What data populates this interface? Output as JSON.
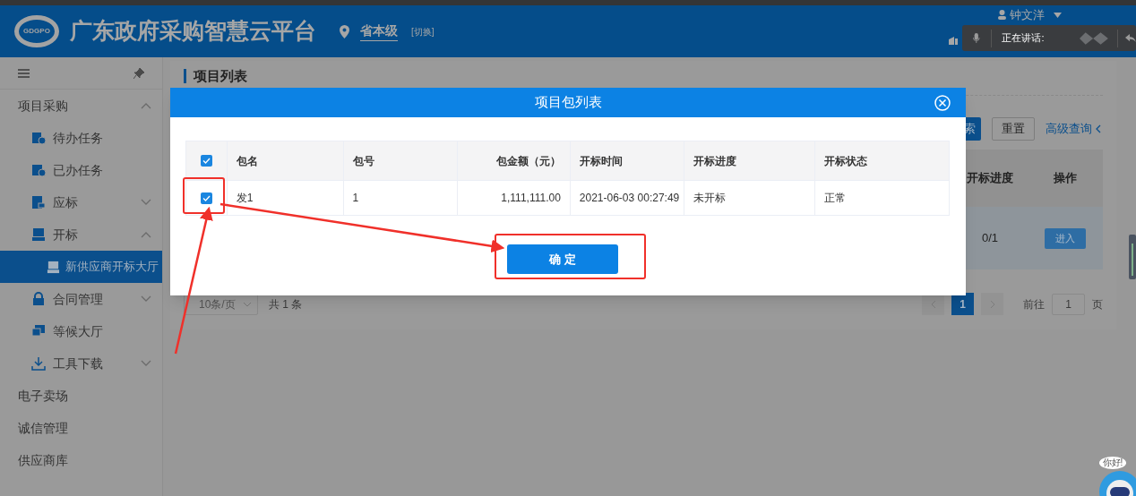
{
  "header": {
    "logo_text": "GDGPO",
    "title": "广东政府采购智慧云平台",
    "location": "省本级",
    "switch": "[切换]",
    "user": "钟文洋"
  },
  "voice_popup": {
    "label": "正在讲话:"
  },
  "sidebar": {
    "items": [
      {
        "label": "项目采购",
        "expanded": true,
        "selected": false,
        "children": [
          {
            "label": "待办任务",
            "selected": false
          },
          {
            "label": "已办任务",
            "selected": false
          },
          {
            "label": "应标",
            "expanded": false,
            "selected": false
          },
          {
            "label": "开标",
            "expanded": true,
            "selected": false,
            "children": [
              {
                "label": "新供应商开标大厅",
                "selected": true
              }
            ]
          },
          {
            "label": "合同管理",
            "expanded": false,
            "selected": false
          },
          {
            "label": "等候大厅",
            "selected": false
          },
          {
            "label": "工具下载",
            "expanded": false,
            "selected": false
          }
        ]
      },
      {
        "label": "电子卖场",
        "selected": false
      },
      {
        "label": "诚信管理",
        "selected": false
      },
      {
        "label": "供应商库",
        "selected": false
      }
    ]
  },
  "page": {
    "title": "项目列表",
    "search_button": "索",
    "reset_button": "重置",
    "advanced_query": "高级查询",
    "table": {
      "columns": [
        "开标进度",
        "操作"
      ],
      "rows": [
        {
          "progress": "0/1",
          "action": "进入"
        }
      ]
    },
    "pagination": {
      "page_size": "10条/页",
      "total": "共 1 条",
      "pages": [
        {
          "label": "1",
          "selected": true
        }
      ],
      "goto_label": "前往",
      "goto_value": "1",
      "page_suffix": "页"
    }
  },
  "dialog": {
    "title": "项目包列表",
    "select_all_checked": true,
    "columns": [
      "包名",
      "包号",
      "包金额（元）",
      "开标时间",
      "开标进度",
      "开标状态"
    ],
    "rows": [
      {
        "checked": true,
        "cells": [
          "发1",
          "1",
          "1,111,111.00",
          "2021-06-03 00:27:49",
          "未开标",
          "正常"
        ]
      }
    ],
    "confirm": "确 定"
  },
  "assistant": {
    "bubble": "你好!"
  }
}
